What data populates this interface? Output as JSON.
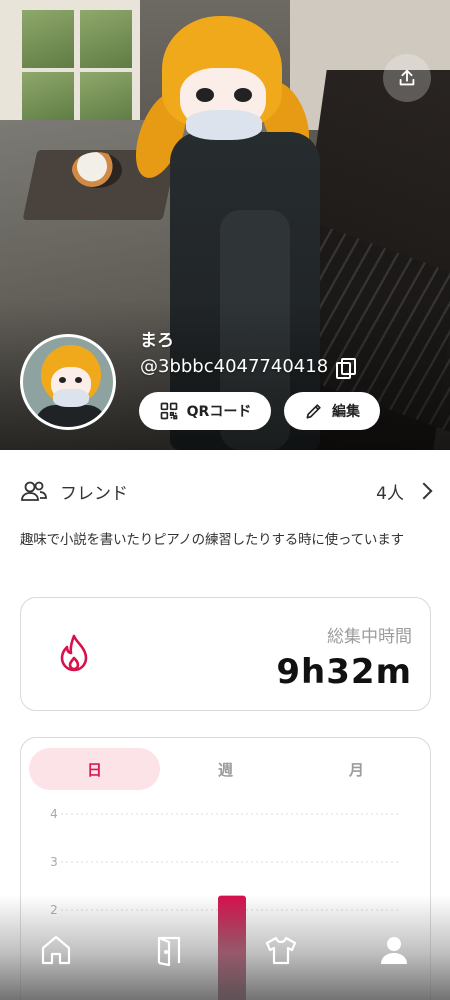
{
  "profile": {
    "name": "まろ",
    "user_id": "@3bbbc4047740418",
    "qr_label": "QRコード",
    "edit_label": "編集"
  },
  "friends": {
    "label": "フレンド",
    "count": "4人"
  },
  "bio": "趣味で小説を書いたりピアノの練習したりする時に使っています",
  "focus": {
    "title": "総集中時間",
    "value": "9h32m"
  },
  "tabs": [
    {
      "label": "日",
      "active": true
    },
    {
      "label": "週",
      "active": false
    },
    {
      "label": "月",
      "active": false
    }
  ],
  "chart_data": {
    "type": "bar",
    "y_ticks": [
      "4",
      "3",
      "2"
    ],
    "ylim": [
      0,
      4
    ],
    "values": [
      2.3
    ],
    "bar_color": "#d8104c"
  },
  "icons": {
    "share": "share-icon",
    "copy": "copy-icon",
    "qr": "qr-icon",
    "edit": "pencil-icon",
    "friends": "people-icon",
    "flame": "flame-icon",
    "nav": [
      "home-icon",
      "door-icon",
      "shirt-icon",
      "profile-icon"
    ]
  },
  "colors": {
    "accent": "#d8104c",
    "tab_active_bg": "#fbe3e8"
  }
}
